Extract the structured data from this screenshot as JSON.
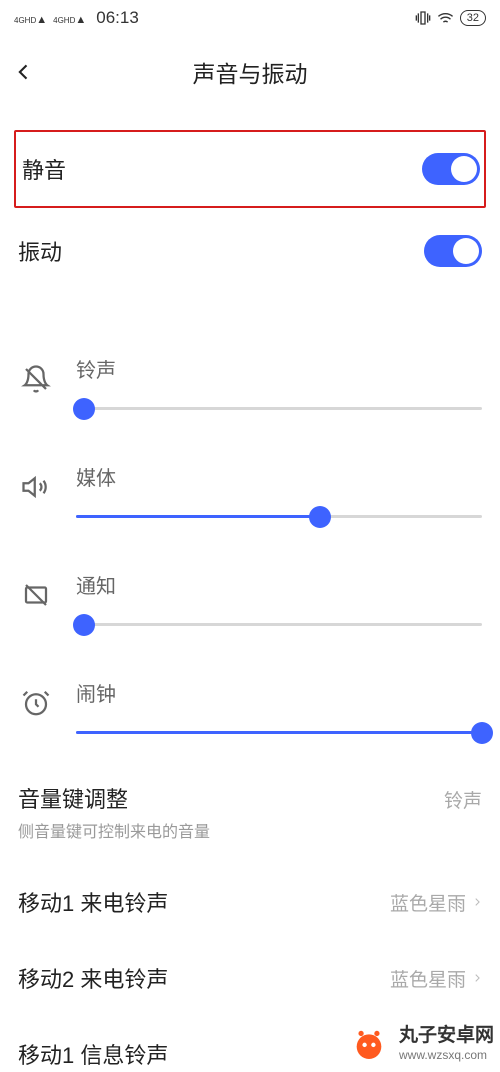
{
  "status_bar": {
    "time": "06:13",
    "battery": "32",
    "signal1_label": "4GHD",
    "signal2_label": "4GHD"
  },
  "nav": {
    "title": "声音与振动"
  },
  "toggles": {
    "mute": {
      "label": "静音",
      "state": "on"
    },
    "vibrate": {
      "label": "振动",
      "state": "on"
    }
  },
  "sliders": {
    "ringtone": {
      "label": "铃声",
      "percent": 2,
      "icon": "bell-off"
    },
    "media": {
      "label": "媒体",
      "percent": 60,
      "icon": "speaker"
    },
    "notification": {
      "label": "通知",
      "percent": 2,
      "icon": "box-mute"
    },
    "alarm": {
      "label": "闹钟",
      "percent": 100,
      "icon": "alarm-clock"
    }
  },
  "volume_key": {
    "label": "音量键调整",
    "subtitle": "侧音量键可控制来电的音量",
    "value": "铃声"
  },
  "ringtone_items": [
    {
      "label": "移动1 来电铃声",
      "value": "蓝色星雨"
    },
    {
      "label": "移动2 来电铃声",
      "value": "蓝色星雨"
    },
    {
      "label": "移动1 信息铃声",
      "value": ""
    }
  ],
  "watermark": {
    "name": "丸子安卓网",
    "url": "www.wzsxq.com"
  },
  "colors": {
    "accent": "#3e63ff",
    "highlight": "#d61c1c"
  }
}
